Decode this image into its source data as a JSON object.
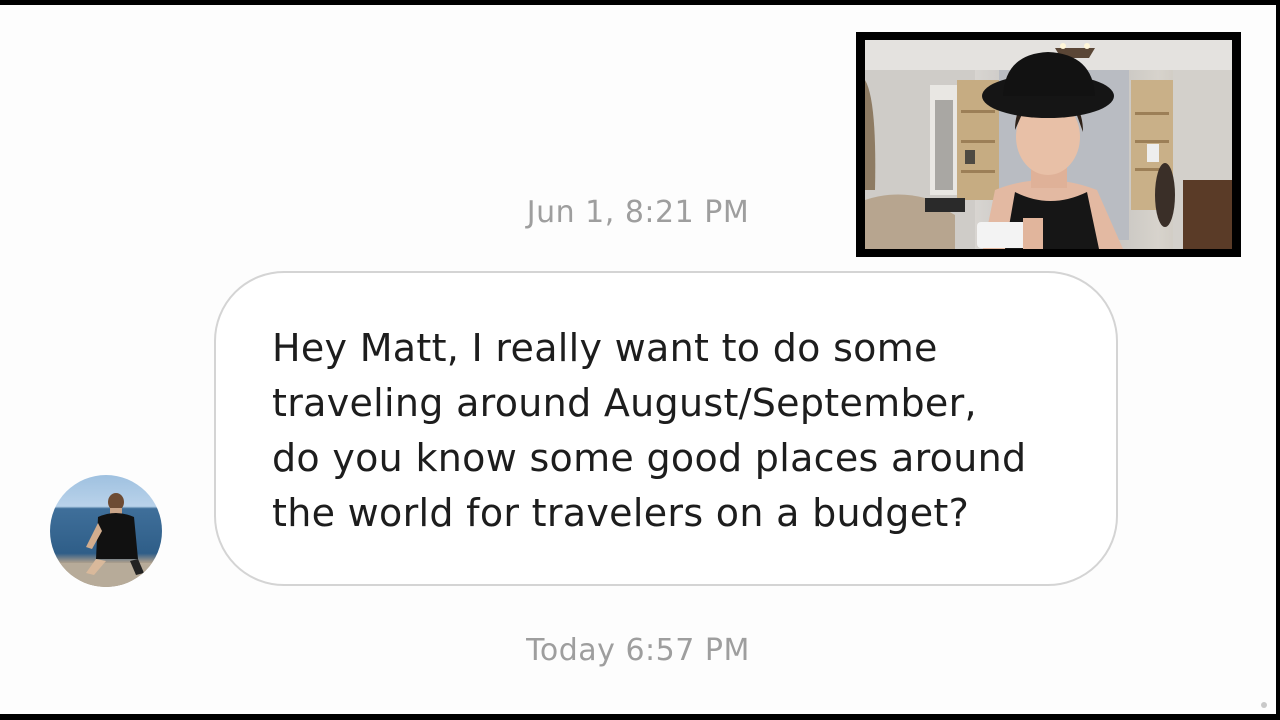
{
  "conversation": {
    "timestamp_top": "Jun 1, 8:21 PM",
    "message": "Hey Matt, I really want to do some\ntraveling around August/September,\ndo you know some good places around\nthe world for travelers on a budget?",
    "timestamp_bottom": "Today 6:57 PM"
  },
  "icons": {
    "avatar": "user-avatar-photo",
    "webcam": "webcam-video-overlay"
  }
}
